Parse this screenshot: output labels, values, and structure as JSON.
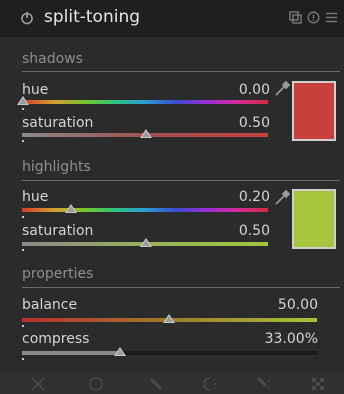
{
  "module": {
    "title": "split-toning"
  },
  "shadows": {
    "section_label": "shadows",
    "hue_label": "hue",
    "hue_value": "0.00",
    "saturation_label": "saturation",
    "saturation_value": "0.50",
    "color": "#c8403c"
  },
  "highlights": {
    "section_label": "highlights",
    "hue_label": "hue",
    "hue_value": "0.20",
    "saturation_label": "saturation",
    "saturation_value": "0.50",
    "color": "#a6c43c"
  },
  "properties": {
    "section_label": "properties",
    "balance_label": "balance",
    "balance_value": "50.00",
    "compress_label": "compress",
    "compress_value": "33.00%"
  },
  "icons": [
    "power-icon",
    "multi-instance-icon",
    "reset-icon",
    "presets-icon",
    "picker-icon",
    "blend-off-icon",
    "blend-uniform-icon",
    "blend-drawn-icon",
    "blend-parametric-icon",
    "blend-drawn-parametric-icon",
    "blend-raster-icon"
  ]
}
